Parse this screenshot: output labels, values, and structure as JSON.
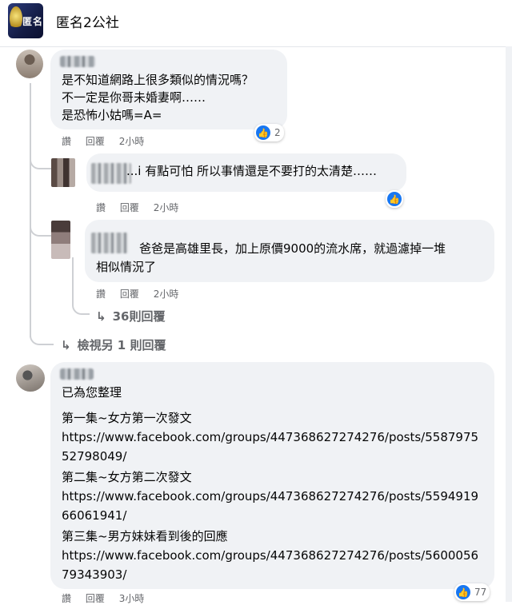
{
  "header": {
    "group_name": "匿名2公社",
    "logo_text": "匿名"
  },
  "comments": [
    {
      "lines": [
        "是不知道網路上很多類似的情況嗎？",
        "不一定是你哥未婚妻啊……",
        "是恐怖小姑嗎=A="
      ],
      "actions": {
        "like": "讚",
        "reply": "回覆",
        "time": "2小時"
      },
      "reaction_count": "2",
      "replies": [
        {
          "text": "...i 有點可怕 所以事情還是不要打的太清楚……",
          "actions": {
            "like": "讚",
            "reply": "回覆",
            "time": "2小時"
          }
        },
        {
          "text": "爸爸是高雄里長，加上原價9000的流水席，就過濾掉一堆相似情況了",
          "line1": "爸爸是高雄里長，加上原價9000的流水席，就過濾掉一堆",
          "line2": "相似情況了",
          "actions": {
            "like": "讚",
            "reply": "回覆",
            "time": "2小時"
          },
          "more_replies": "36則回覆"
        }
      ],
      "view_more": "檢視另 1 則回覆"
    },
    {
      "intro": "已為您整理",
      "episodes": [
        {
          "title": "第一集~女方第一次發文",
          "url": "https://www.facebook.com/groups/447368627274276/posts/558797552798049/"
        },
        {
          "title": "第二集~女方第二次發文",
          "url": "https://www.facebook.com/groups/447368627274276/posts/559491966061941/"
        },
        {
          "title": "第三集~男方妹妹看到後的回應",
          "url": "https://www.facebook.com/groups/447368627274276/posts/560005679343903/"
        }
      ],
      "actions": {
        "like": "讚",
        "reply": "回覆",
        "time": "3小時"
      },
      "reaction_count": "77"
    }
  ],
  "icons": {
    "like": "like-thumb-icon",
    "reply_arrow": "reply-arrow-icon"
  },
  "colors": {
    "like_blue": "#1877f2",
    "bubble": "#f0f2f5",
    "meta": "#65676b"
  }
}
